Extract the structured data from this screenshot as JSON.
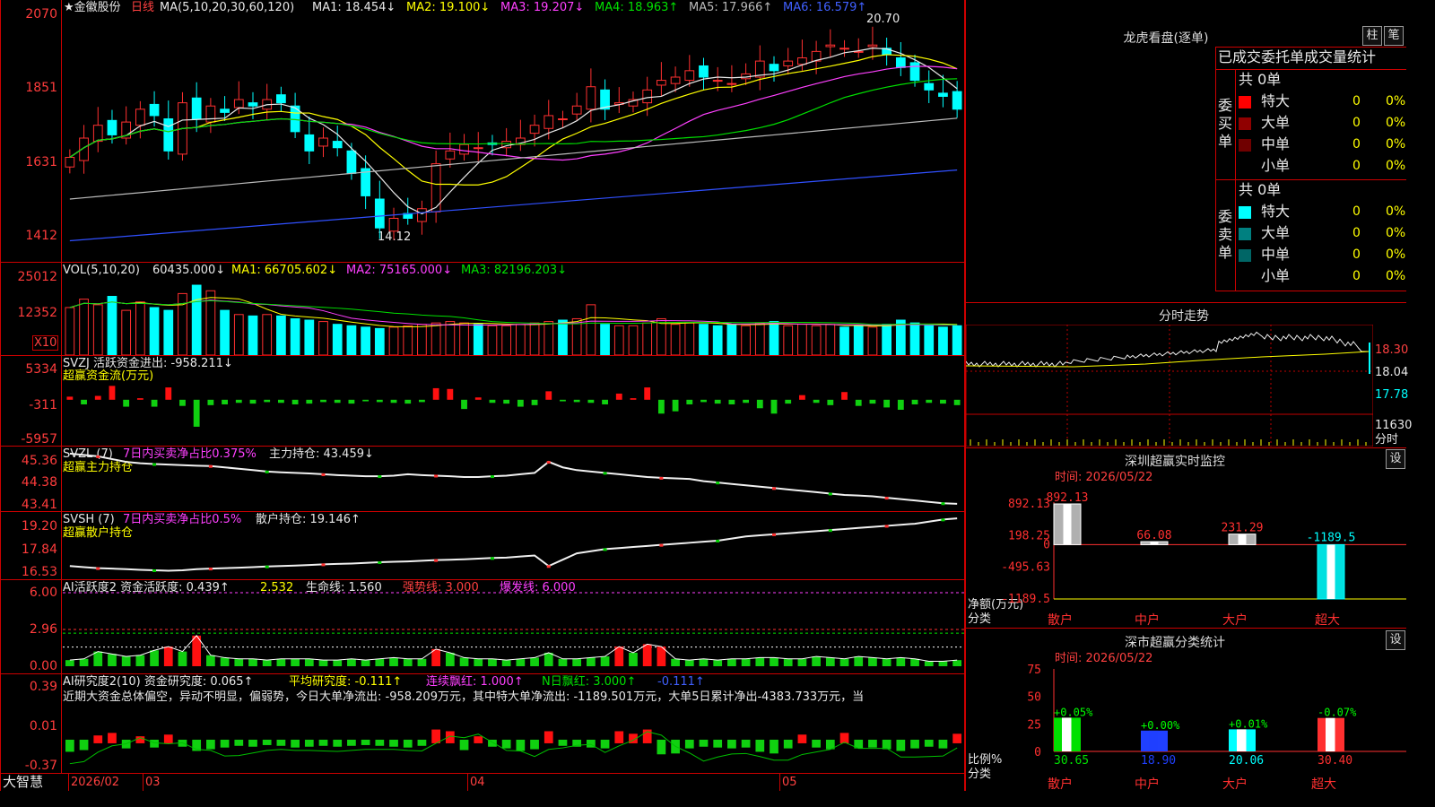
{
  "stock": {
    "name": "★金徽股份",
    "period": "日线",
    "ma_label": "MA(5,10,20,30,60,120)",
    "ma": [
      {
        "t": "MA1: 18.454↓",
        "c": "#e8e8e8"
      },
      {
        "t": "MA2: 19.100↓",
        "c": "#ffff00"
      },
      {
        "t": "MA3: 19.207↓",
        "c": "#ff40ff"
      },
      {
        "t": "MA4: 18.963↑",
        "c": "#00e000"
      },
      {
        "t": "MA5: 17.966↑",
        "c": "#bbbbbb"
      },
      {
        "t": "MA6: 16.579↑",
        "c": "#4060ff"
      }
    ],
    "high_mark": "20.70",
    "low_mark": "14.12"
  },
  "colors": {
    "up": "#ff3030",
    "down": "#00ffff",
    "grid": "#c00000"
  },
  "price_axis": [
    "2070",
    "1851",
    "1631",
    "1412"
  ],
  "vol": {
    "label": "VOL(5,10,20)",
    "val": "60435.000↓",
    "ma": [
      {
        "t": "MA1: 66705.602↓",
        "c": "#ffff00"
      },
      {
        "t": "MA2: 75165.000↓",
        "c": "#ff40ff"
      },
      {
        "t": "MA3: 82196.203↓",
        "c": "#00e000"
      }
    ],
    "axis": [
      "25012",
      "12352"
    ],
    "unit": "X10"
  },
  "svzj": {
    "label": "SVZJ  活跃资金进出: -958.211↓",
    "sub": "超赢资金流(万元)",
    "axis": [
      "5334",
      "-311",
      "-5957"
    ]
  },
  "svzl": {
    "label": "SVZL (7)",
    "l2": "7日内买卖净占比0.375%",
    "l3": "主力持仓: 43.459↓",
    "sub": "超赢主力持仓",
    "axis": [
      "45.36",
      "44.38",
      "43.41"
    ]
  },
  "svsh": {
    "label": "SVSH (7)",
    "l2": "7日内买卖净占比0.5%",
    "l3": "散户持仓: 19.146↑",
    "sub": "超赢散户持仓",
    "axis": [
      "19.20",
      "17.84",
      "16.53"
    ]
  },
  "ai1": {
    "l1": "AI活跃度2 资金活跃度: 0.439↑",
    "l2": "2.532",
    "l3": "生命线: 1.560",
    "l4": "强势线: 3.000",
    "l5": "爆发线: 6.000",
    "axis": [
      "6.00",
      "2.96",
      "0.00"
    ]
  },
  "ai2": {
    "l1": "AI研究度2(10) 资金研究度: 0.065↑",
    "l2": "平均研究度: -0.111↑",
    "l3": "连续飘红: 1.000↑",
    "l4": "N日飘红: 3.000↑",
    "l5": "-0.111↑",
    "desc": "近期大资金总体偏空，异动不明显，偏弱势，今日大单净流出: -958.209万元，其中特大单净流出: -1189.501万元，大单5日累计净出-4383.733万元，当",
    "axis": [
      "0.39",
      "0.01",
      "-0.37"
    ]
  },
  "bottom": {
    "brand": "大智慧",
    "dates": [
      "2026/02",
      "03",
      "04",
      "05"
    ]
  },
  "lhb": {
    "title": "龙虎看盘(逐单)",
    "btn1": "柱",
    "btn2": "笔",
    "tabs": "已成交委托单成交量统计",
    "buy_label": "委买单",
    "sell_label": "委卖单",
    "buy": {
      "total": "共 0单",
      "rows": [
        {
          "n": "特大",
          "c": "#ff0000",
          "v": "0",
          "p": "0%"
        },
        {
          "n": "大单",
          "c": "#900000",
          "v": "0",
          "p": "0%"
        },
        {
          "n": "中单",
          "c": "#700000",
          "v": "0",
          "p": "0%"
        },
        {
          "n": "小单",
          "c": "",
          "v": "0",
          "p": "0%"
        }
      ]
    },
    "sell": {
      "total": "共 0单",
      "rows": [
        {
          "n": "特大",
          "c": "#00ffff",
          "v": "0",
          "p": "0%"
        },
        {
          "n": "大单",
          "c": "#008080",
          "v": "0",
          "p": "0%"
        },
        {
          "n": "中单",
          "c": "#006666",
          "v": "0",
          "p": "0%"
        },
        {
          "n": "小单",
          "c": "",
          "v": "0",
          "p": "0%"
        }
      ]
    }
  },
  "fenshi": {
    "title": "分时走势",
    "axis": [
      "18.30",
      "18.04",
      "17.78"
    ],
    "vol": "11630",
    "unit": "分时"
  },
  "monitor": {
    "title": "深圳超赢实时监控",
    "btn": "设",
    "time": "时间: 2026/05/22",
    "axis": [
      "892.13",
      "198.25",
      "0",
      "-495.63",
      "-1189.5"
    ],
    "ylabel": "净额(万元)",
    "xlabel": "分类",
    "bars": [
      {
        "cat": "散户",
        "value": 892.13,
        "label": "892.13"
      },
      {
        "cat": "中户",
        "value": 66.08,
        "label": "66.08"
      },
      {
        "cat": "大户",
        "value": 231.29,
        "label": "231.29"
      },
      {
        "cat": "超大",
        "value": -1189.5,
        "label": "-1189.5"
      }
    ]
  },
  "stats": {
    "title": "深市超赢分类统计",
    "btn": "设",
    "time": "时间: 2026/05/22",
    "axis": [
      "75",
      "50",
      "25",
      "0"
    ],
    "ylabel": "比例%",
    "xlabel": "分类",
    "bars": [
      {
        "cat": "散户",
        "value": 30.65,
        "chg": "+0.05%",
        "label": "30.65",
        "c": "#00e000"
      },
      {
        "cat": "中户",
        "value": 18.9,
        "chg": "+0.00%",
        "label": "18.90",
        "c": "#2040ff"
      },
      {
        "cat": "大户",
        "value": 20.06,
        "chg": "+0.01%",
        "label": "20.06",
        "c": "#00ffff"
      },
      {
        "cat": "超大",
        "value": 30.4,
        "chg": "-0.07%",
        "label": "30.40",
        "c": "#ff3030"
      }
    ]
  },
  "chart_data": [
    {
      "type": "candlestick",
      "title": "金徽股份 日线",
      "x_start": "2026/02",
      "x_ticks": [
        "03",
        "04",
        "05"
      ],
      "ylim": [
        1412,
        2070
      ],
      "close": [
        16.8,
        17.4,
        17.8,
        17.5,
        17.9,
        18.3,
        18.1,
        17.0,
        18.5,
        18.0,
        18.4,
        18.2,
        18.6,
        18.4,
        18.6,
        18.5,
        17.6,
        17.0,
        17.4,
        17.1,
        16.3,
        15.6,
        14.6,
        14.9,
        14.9,
        15.2,
        16.6,
        17.0,
        17.2,
        17.1,
        17.2,
        17.3,
        17.4,
        17.8,
        18.1,
        18.0,
        18.4,
        19.0,
        18.3,
        18.5,
        18.6,
        18.9,
        19.2,
        19.3,
        19.5,
        19.3,
        19.2,
        19.1,
        19.4,
        19.8,
        19.5,
        19.8,
        19.9,
        20.1,
        20.3,
        20.2,
        20.1,
        20.3,
        20.0,
        19.6,
        19.2,
        18.9,
        18.7,
        18.3
      ],
      "vol": [
        17000,
        20000,
        18000,
        21000,
        16000,
        19000,
        17000,
        16000,
        22000,
        25000,
        23000,
        16000,
        14500,
        14000,
        14500,
        14000,
        13000,
        12500,
        12000,
        11000,
        10500,
        10000,
        9500,
        10000,
        10500,
        11000,
        11500,
        12000,
        11500,
        11000,
        10500,
        10500,
        11000,
        11500,
        12000,
        12500,
        13000,
        18000,
        11000,
        10500,
        10500,
        11500,
        13000,
        11000,
        11500,
        11000,
        10500,
        11000,
        10500,
        11500,
        12000,
        10500,
        11000,
        10500,
        11000,
        10000,
        10500,
        10000,
        11000,
        12500,
        11500,
        10500,
        10000,
        10500
      ]
    },
    {
      "type": "bar",
      "title": "超赢资金流(万元)",
      "ylim": [
        -5957,
        5334
      ],
      "values": [
        400,
        -600,
        500,
        1800,
        -900,
        200,
        -900,
        1600,
        -800,
        -3500,
        -700,
        -600,
        -400,
        -500,
        -300,
        -400,
        -600,
        -500,
        -300,
        -400,
        -500,
        -200,
        -300,
        -400,
        -500,
        -300,
        1500,
        1400,
        -1200,
        300,
        -400,
        -500,
        -900,
        -700,
        1100,
        -200,
        -300,
        -400,
        -600,
        800,
        200,
        1600,
        -1800,
        -1500,
        -600,
        -300,
        -500,
        -600,
        -400,
        -1100,
        -1800,
        -500,
        600,
        -400,
        -700,
        1000,
        -800,
        -500,
        -1000,
        -1300,
        -600,
        -400,
        -500,
        -700
      ]
    },
    {
      "type": "line",
      "title": "超赢主力持仓",
      "ylim": [
        43.41,
        45.36
      ],
      "values": [
        45.3,
        45.25,
        45.2,
        45.1,
        45.0,
        44.95,
        44.92,
        44.9,
        44.88,
        44.86,
        44.85,
        44.8,
        44.75,
        44.7,
        44.65,
        44.62,
        44.6,
        44.58,
        44.55,
        44.52,
        44.5,
        44.48,
        44.48,
        44.5,
        44.55,
        44.52,
        44.5,
        44.48,
        44.45,
        44.45,
        44.48,
        44.5,
        44.55,
        44.6,
        45.0,
        44.8,
        44.7,
        44.65,
        44.6,
        44.55,
        44.5,
        44.45,
        44.42,
        44.4,
        44.38,
        44.3,
        44.25,
        44.2,
        44.15,
        44.1,
        44.05,
        44.0,
        43.95,
        43.9,
        43.85,
        43.8,
        43.78,
        43.75,
        43.7,
        43.65,
        43.6,
        43.55,
        43.5,
        43.48
      ]
    },
    {
      "type": "line",
      "title": "超赢散户持仓",
      "ylim": [
        16.53,
        19.2
      ],
      "values": [
        16.9,
        16.85,
        16.8,
        16.78,
        16.75,
        16.72,
        16.7,
        16.68,
        16.7,
        16.75,
        16.78,
        16.8,
        16.82,
        16.85,
        16.88,
        16.9,
        16.92,
        16.95,
        16.98,
        17.0,
        17.02,
        17.05,
        17.08,
        17.1,
        17.12,
        17.15,
        17.18,
        17.2,
        17.22,
        17.25,
        17.28,
        17.3,
        17.35,
        17.4,
        16.9,
        17.2,
        17.5,
        17.6,
        17.7,
        17.75,
        17.8,
        17.85,
        17.9,
        17.95,
        18.0,
        18.05,
        18.1,
        18.2,
        18.3,
        18.35,
        18.4,
        18.45,
        18.5,
        18.55,
        18.6,
        18.65,
        18.7,
        18.75,
        18.8,
        18.85,
        18.9,
        19.0,
        19.1,
        19.15
      ]
    },
    {
      "type": "bar",
      "title": "AI活跃度2",
      "ylim": [
        0,
        6
      ],
      "lines": {
        "生命线": 1.56,
        "强势线": 3.0,
        "爆发线": 6.0
      },
      "values": [
        0.5,
        0.6,
        1.2,
        1.0,
        0.8,
        0.9,
        1.3,
        1.6,
        1.2,
        2.5,
        0.9,
        0.7,
        0.6,
        0.6,
        0.5,
        0.6,
        0.6,
        0.6,
        0.5,
        0.5,
        0.6,
        0.5,
        0.6,
        0.7,
        0.6,
        0.6,
        1.4,
        1.1,
        0.7,
        0.6,
        0.6,
        0.5,
        0.6,
        0.7,
        1.1,
        0.6,
        0.6,
        0.7,
        0.8,
        1.6,
        1.1,
        1.8,
        1.6,
        0.6,
        0.5,
        0.6,
        0.5,
        0.6,
        0.6,
        0.7,
        0.7,
        0.6,
        0.6,
        0.8,
        0.7,
        0.6,
        0.8,
        0.7,
        0.6,
        0.7,
        0.6,
        0.4,
        0.4,
        0.5
      ]
    },
    {
      "type": "bar",
      "title": "AI研究度2(10)",
      "ylim": [
        -0.37,
        0.39
      ],
      "values": [
        -0.1,
        -0.08,
        0.05,
        0.08,
        -0.06,
        0.04,
        -0.05,
        0.06,
        -0.04,
        -0.09,
        -0.07,
        -0.05,
        -0.03,
        -0.04,
        -0.02,
        -0.03,
        -0.05,
        -0.04,
        -0.03,
        -0.04,
        -0.03,
        -0.02,
        -0.03,
        -0.04,
        -0.05,
        -0.03,
        0.12,
        0.1,
        -0.08,
        0.04,
        -0.04,
        -0.06,
        -0.09,
        -0.07,
        0.1,
        -0.03,
        -0.04,
        -0.05,
        -0.06,
        0.1,
        0.07,
        0.12,
        -0.13,
        -0.12,
        -0.06,
        -0.04,
        -0.05,
        -0.06,
        -0.05,
        -0.1,
        -0.12,
        -0.06,
        0.06,
        -0.05,
        -0.07,
        0.08,
        -0.06,
        -0.05,
        -0.07,
        -0.09,
        -0.06,
        -0.04,
        -0.06,
        0.07
      ]
    }
  ]
}
